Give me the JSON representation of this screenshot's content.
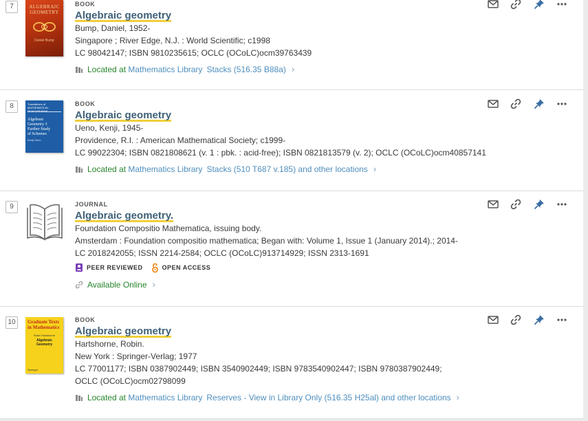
{
  "records": [
    {
      "index": "7",
      "type": "BOOK",
      "title": "Algebraic geometry",
      "author": "Bump, Daniel, 1952-",
      "publisher": "Singapore ; River Edge, N.J. : World Scientific; c1998",
      "ids": "LC 98042147; ISBN 9810235615; OCLC (OCoLC)ocm39763439",
      "avail_status": "Located at",
      "avail_library": "Mathematics Library",
      "avail_location": "Stacks (516.35 B88a)",
      "cover": {
        "line1": "ALGEBRAIC",
        "line2": "GEOMETRY",
        "author": "Daniel Bump"
      }
    },
    {
      "index": "8",
      "type": "BOOK",
      "title": "Algebraic geometry",
      "author": "Ueno, Kenji, 1945-",
      "publisher": "Providence, R.I. : American Mathematical Society; c1999-",
      "ids": "LC 99022304; ISBN 0821808621 (v. 1 : pbk. : acid-free); ISBN 0821813579 (v. 2); OCLC (OCoLC)ocm40857141",
      "avail_status": "Located at",
      "avail_library": "Mathematics Library",
      "avail_location": "Stacks (510 T687 v.185) and other locations",
      "cover": {
        "series": "Translations of MATHEMATICAL MONOGRAPHS",
        "line1": "Algebraic",
        "line2": "Geometry 3",
        "line3": "Further Study",
        "line4": "of Schemes",
        "author": "Kenji Ueno"
      }
    },
    {
      "index": "9",
      "type": "JOURNAL",
      "title": "Algebraic geometry.",
      "author": "Foundation Compositio Mathematica, issuing body.",
      "publisher": "Amsterdam : Foundation compositio mathematica; Began with: Volume 1, Issue 1 (January 2014).; 2014-",
      "ids": "LC 2018242055; ISSN 2214-2584; OCLC (OCoLC)913714929; ISSN 2313-1691",
      "badges": {
        "peer": "PEER REVIEWED",
        "open": "OPEN ACCESS"
      },
      "avail_status": "Available Online"
    },
    {
      "index": "10",
      "type": "BOOK",
      "title": "Algebraic geometry",
      "author": "Hartshorne, Robin.",
      "publisher": "New York : Springer-Verlag; 1977",
      "ids": "LC 77001177; ISBN 0387902449; ISBN 3540902449; ISBN 9783540902447; ISBN 9780387902449; OCLC (OCoLC)ocm02798099",
      "avail_status": "Located at",
      "avail_library": "Mathematics Library",
      "avail_location": "Reserves - View in Library Only (516.35 H25al) and other locations",
      "cover": {
        "series1": "Graduate Texts",
        "series2": "in Mathematics",
        "author": "Robin Hartshorne",
        "line1": "Algebraic",
        "line2": "Geometry",
        "publisher": "Springer"
      }
    }
  ],
  "icons": {
    "actions": [
      "email-icon",
      "link-icon",
      "pin-icon",
      "more-icon"
    ],
    "location": "book-location-icon",
    "online": "link-small-icon"
  },
  "colors": {
    "title": "#3f6179",
    "highlight": "#f1cf3a",
    "green": "#26842a",
    "link": "#4e8ebd",
    "pin": "#3a6da3"
  }
}
